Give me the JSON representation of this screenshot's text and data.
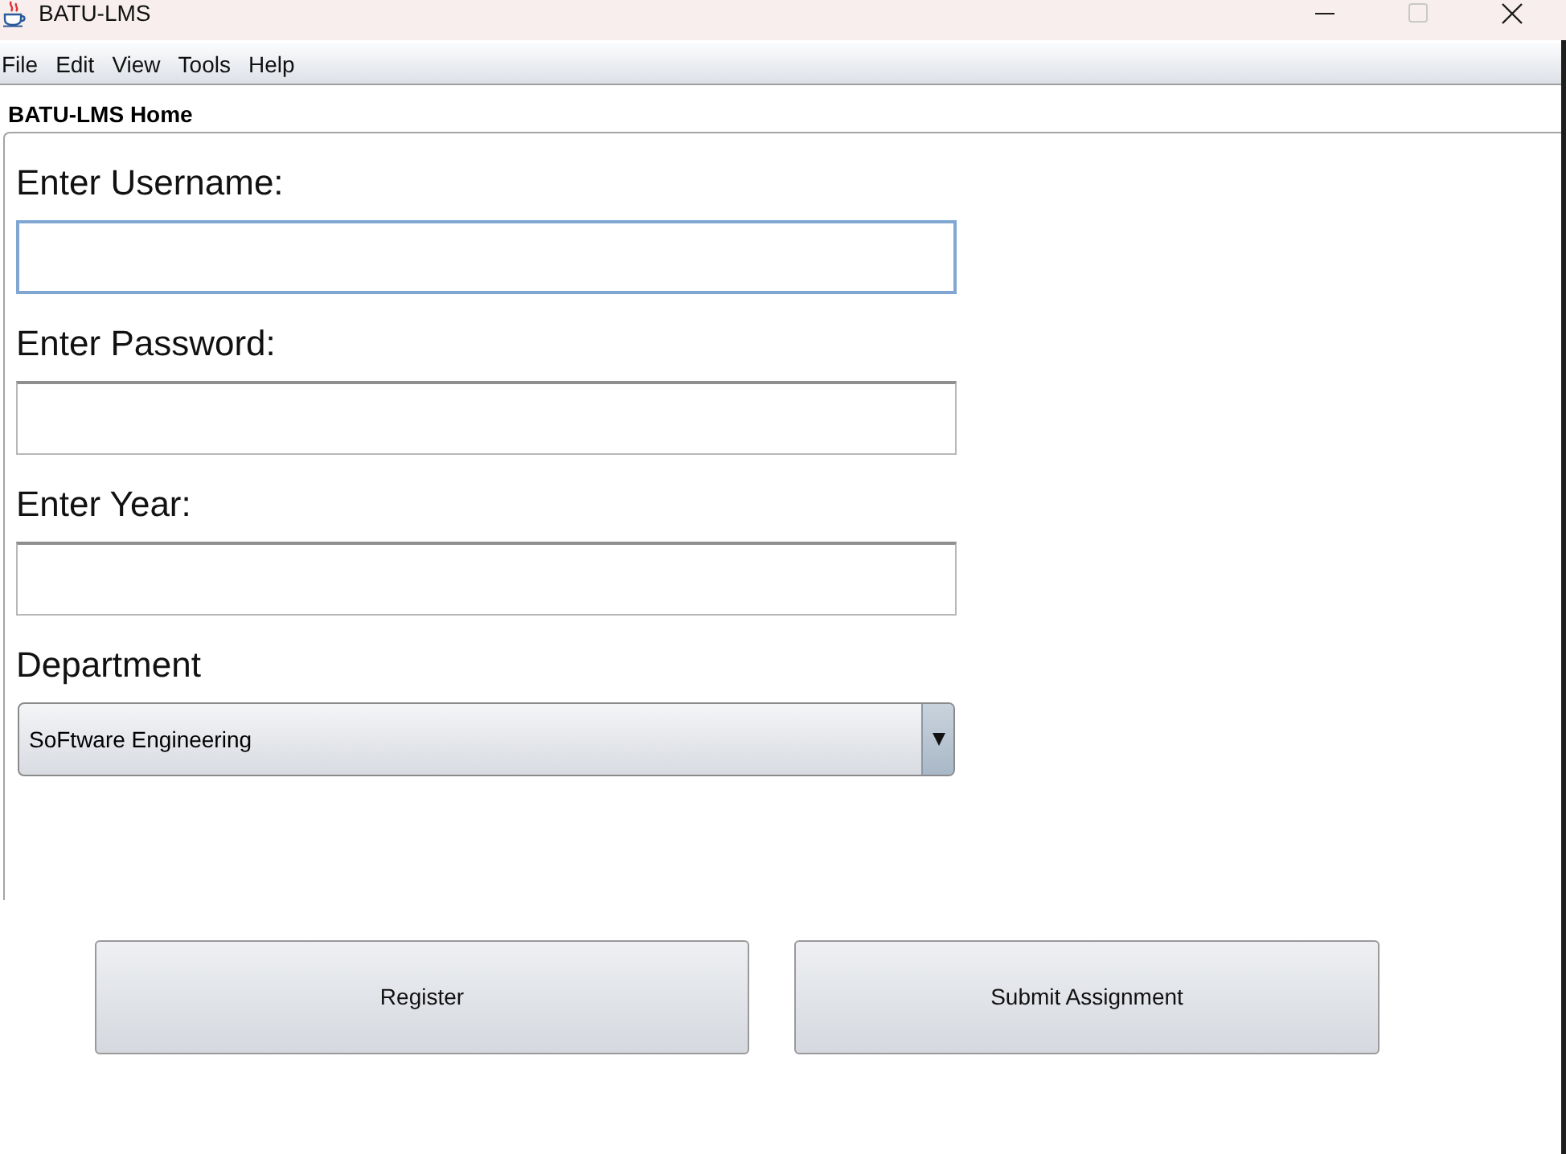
{
  "window": {
    "title": "BATU-LMS",
    "controls": [
      {
        "kind": "minimize",
        "disabled": false
      },
      {
        "kind": "maximize",
        "disabled": true
      },
      {
        "kind": "close",
        "disabled": false
      }
    ]
  },
  "menu_bar": [
    "File",
    "Edit",
    "View",
    "Tools",
    "Help"
  ],
  "panel": {
    "title": "BATU-LMS Home"
  },
  "form": {
    "fields": [
      {
        "kind": "text",
        "label": "Enter Username:",
        "focused": true
      },
      {
        "kind": "password",
        "label": "Enter Password:",
        "focused": false
      },
      {
        "kind": "text",
        "label": "Enter Year:",
        "focused": false
      },
      {
        "kind": "select",
        "label": "Department",
        "value": "SoFtware Engineering",
        "focused": false
      }
    ]
  },
  "buttons": [
    "Register",
    "Submit Assignment"
  ]
}
